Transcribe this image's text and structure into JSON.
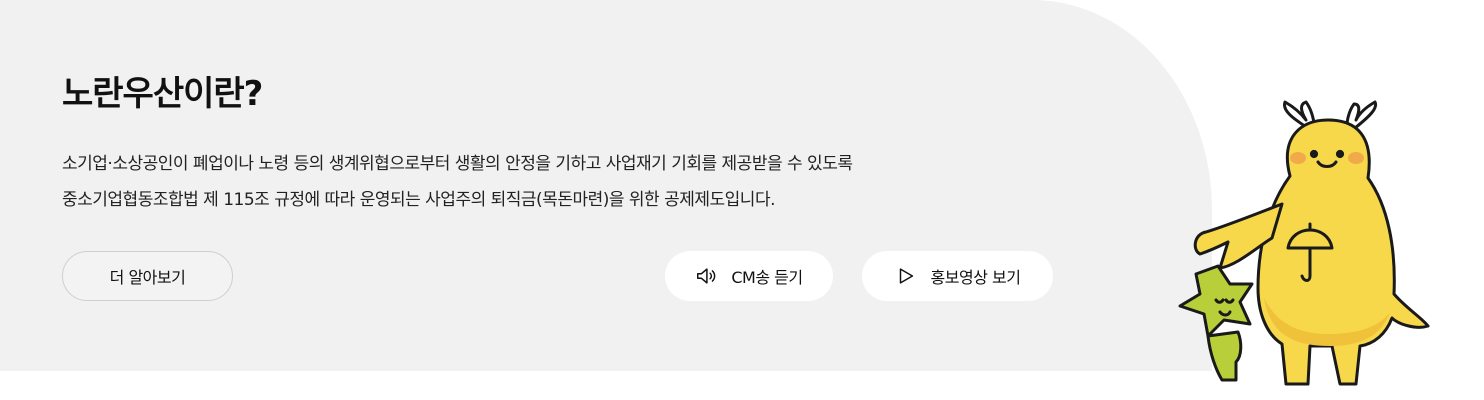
{
  "section": {
    "title": "노란우산이란?",
    "description_lines": [
      "소기업·소상공인이 폐업이나 노령 등의 생계위협으로부터 생활의 안정을 기하고 사업재기 기회를 제공받을 수 있도록",
      "중소기업협동조합법 제 115조 규정에 따라 운영되는 사업주의 퇴직금(목돈마련)을 위한 공제제도입니다."
    ]
  },
  "buttons": {
    "more_label": "더 알아보기",
    "cm_song_label": "CM송 듣기",
    "cm_song_icon": "speaker-icon",
    "promo_video_label": "홍보영상 보기",
    "promo_video_icon": "play-icon"
  },
  "illustration": {
    "name": "yellow-umbrella-mascot",
    "colors": {
      "body": "#f7d84a",
      "shade": "#f0c13a",
      "star": "#b9cf3a",
      "outline": "#1a1a1a"
    }
  },
  "colors": {
    "panel_background": "#f1f1f1",
    "button_background": "#ffffff"
  }
}
